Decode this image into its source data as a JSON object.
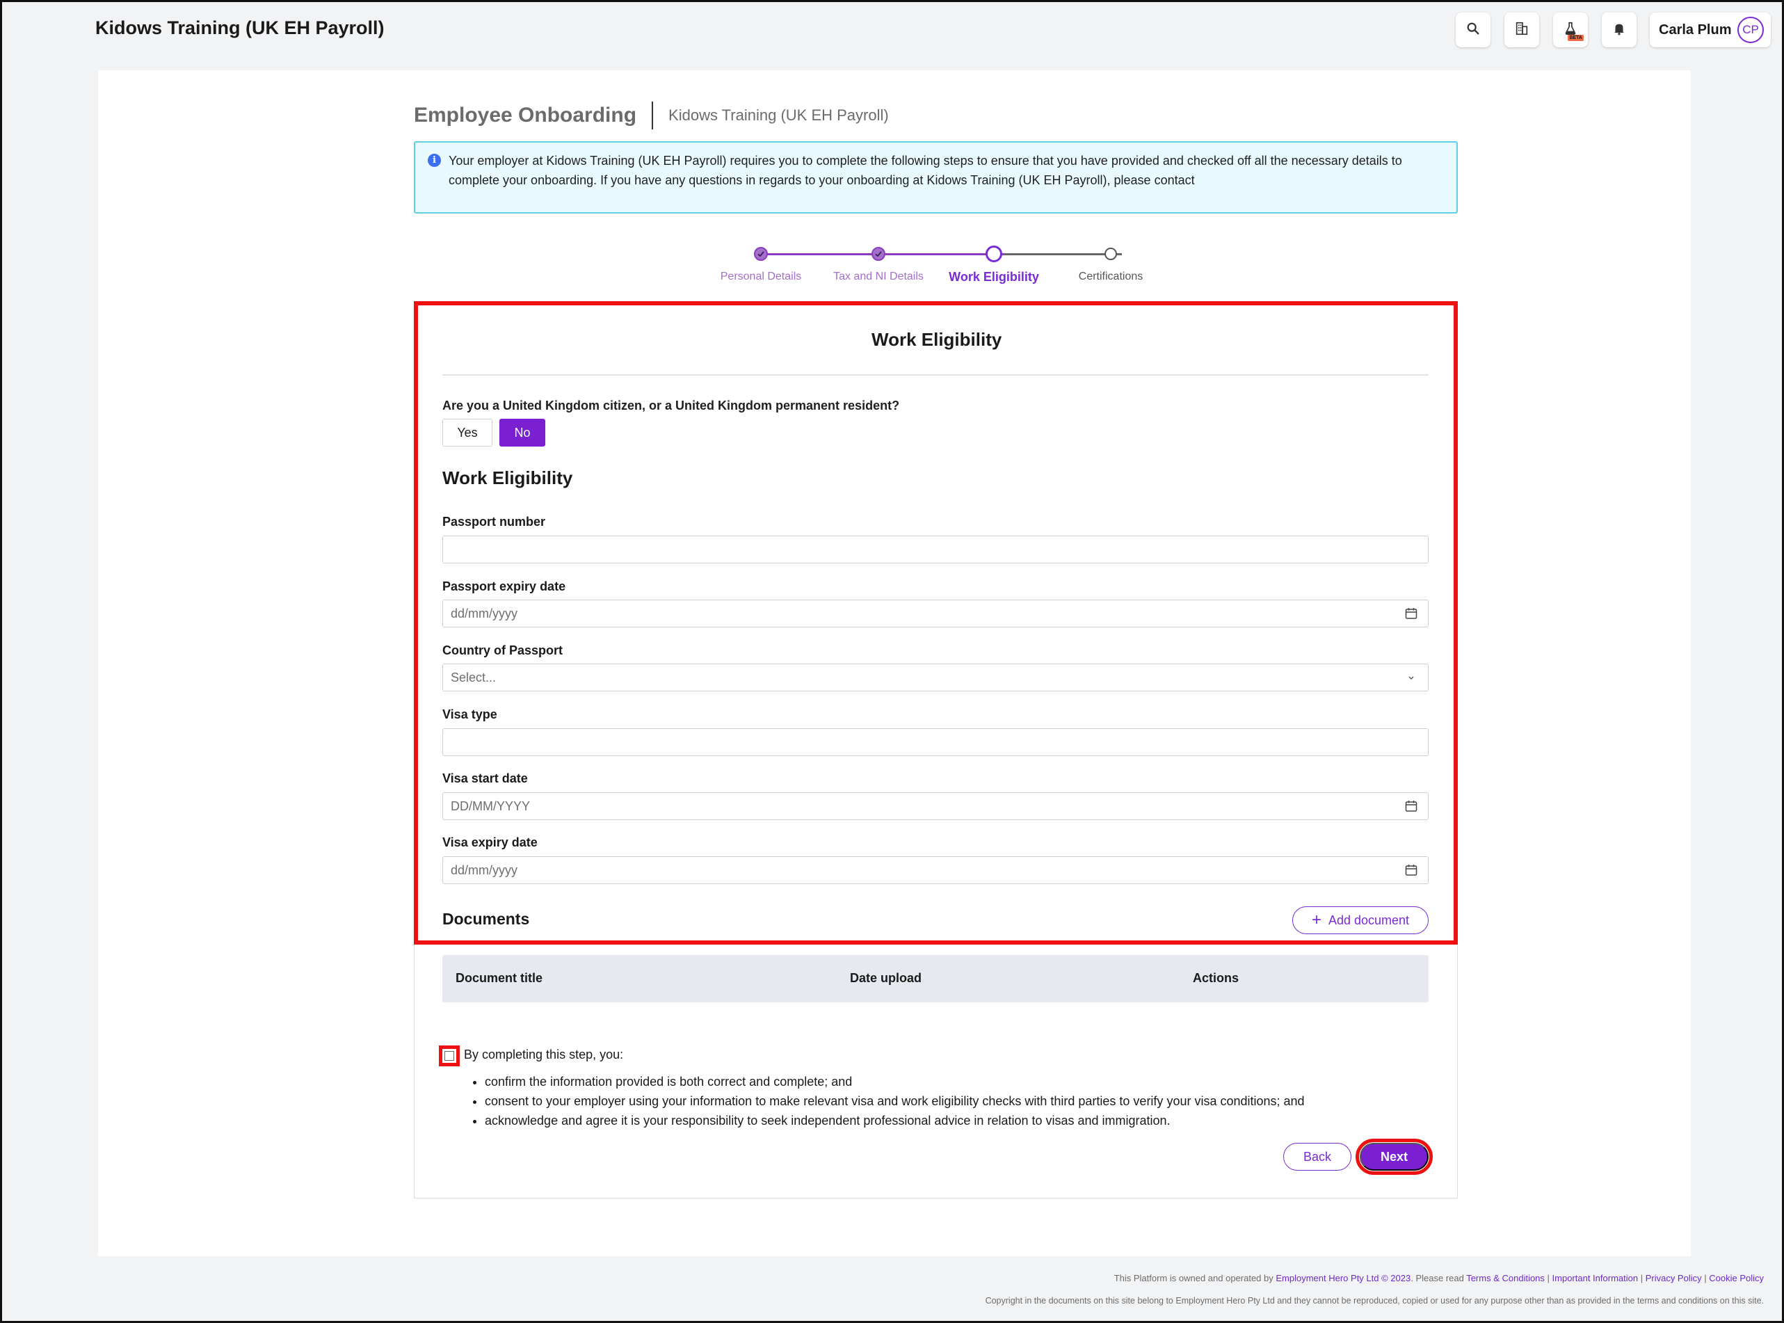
{
  "header": {
    "company_title": "Kidows Training (UK EH Payroll)",
    "user_name": "Carla Plum",
    "user_initials": "CP",
    "beta_label": "BETA",
    "icons": [
      "search-icon",
      "buildings-icon",
      "flask-beta-icon",
      "bell-icon"
    ]
  },
  "page": {
    "title": "Employee Onboarding",
    "subtitle": "Kidows Training (UK EH Payroll)",
    "info_message": "Your employer at Kidows Training (UK EH Payroll) requires you to complete the following steps to ensure that you have provided and checked off all the necessary details to complete your onboarding. If you have any questions in regards to your onboarding at Kidows Training (UK EH Payroll), please contact"
  },
  "stepper": {
    "steps": [
      {
        "label": "Personal Details",
        "state": "done"
      },
      {
        "label": "Tax and NI Details",
        "state": "done"
      },
      {
        "label": "Work Eligibility",
        "state": "current"
      },
      {
        "label": "Certifications",
        "state": "todo"
      }
    ]
  },
  "form": {
    "title": "Work Eligibility",
    "question": "Are you a United Kingdom citizen, or a United Kingdom permanent resident?",
    "yes_label": "Yes",
    "no_label": "No",
    "selected_answer": "No",
    "section_heading": "Work Eligibility",
    "fields": {
      "passport_number": {
        "label": "Passport number",
        "value": "",
        "placeholder": ""
      },
      "passport_expiry": {
        "label": "Passport expiry date",
        "placeholder": "dd/mm/yyyy"
      },
      "passport_country": {
        "label": "Country of Passport",
        "placeholder": "Select..."
      },
      "visa_type": {
        "label": "Visa type",
        "value": "",
        "placeholder": ""
      },
      "visa_start": {
        "label": "Visa start date",
        "placeholder": "DD/MM/YYYY"
      },
      "visa_expiry": {
        "label": "Visa expiry date",
        "placeholder": "dd/mm/yyyy"
      }
    }
  },
  "documents": {
    "heading": "Documents",
    "add_label": "Add document",
    "columns": [
      "Document title",
      "Date upload",
      "Actions"
    ]
  },
  "consent": {
    "intro": "By completing this step, you:",
    "items": [
      "confirm the information provided is both correct and complete; and",
      "consent to your employer using your information to make relevant visa and work eligibility checks with third parties to verify your visa conditions; and",
      "acknowledge and agree it is your responsibility to seek independent professional advice in relation to visas and immigration."
    ],
    "checked": false
  },
  "actions": {
    "back_label": "Back",
    "next_label": "Next"
  },
  "footer": {
    "owned_prefix": "This Platform is owned and operated by ",
    "owner_link": "Employment Hero Pty Ltd © 2023",
    "read_text": ". Please read ",
    "link_terms": "Terms & Conditions",
    "link_important": "Important Information",
    "link_privacy": "Privacy Policy",
    "link_cookie": "Cookie Policy",
    "separator": " | ",
    "copyright": "Copyright in the documents on this site belong to Employment Hero Pty Ltd and they cannot be reproduced, copied or used for any purpose other than as provided in the terms and conditions on this site."
  },
  "colors": {
    "brand_purple": "#7a1fd1",
    "highlight_red": "#ee1111",
    "info_bg": "#e8fafd",
    "info_border": "#5ed0e6"
  }
}
